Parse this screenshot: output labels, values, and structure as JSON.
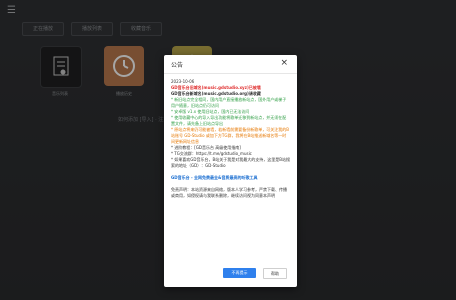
{
  "app": {
    "menu_icon": "hamburger-menu-icon",
    "tabs": [
      {
        "label": "正在播放"
      },
      {
        "label": "播放列表"
      },
      {
        "label": "收藏音乐"
      }
    ],
    "tiles": [
      {
        "label": "音乐列表",
        "icon": "music-list-icon",
        "color": "#1f2021"
      },
      {
        "label": "播放历史",
        "icon": "history-clock-icon",
        "color": "#b9794e"
      },
      {
        "label": "",
        "icon": "star-icon",
        "color": "#b8a64a"
      }
    ],
    "hint": "如何添加 [导入] · 注意事项 · 共 7 行"
  },
  "dialog": {
    "title": "公告",
    "lines": [
      {
        "text": "2023-10-06",
        "cls": ""
      },
      {
        "text": "GD音乐台旧域名(music.gdstudio.xyz)已被墙",
        "cls": "red"
      },
      {
        "text": "GD音乐台新域名(music.gdstudio.org)请收藏",
        "cls": "b"
      },
      {
        "text": "* 新旧站点完全相同，国内用户直接播放新站点，国外用户或梯子用户随意，旧站点仍可访问",
        "cls": "green"
      },
      {
        "text": "* 安卓版 v1.x 使用旧站点，国内已无法访问",
        "cls": "green"
      },
      {
        "text": "* 使用收藏中心的导入导出功能将歌单迁移到新站点，并无须在配置文件，请先备上旧站点导出",
        "cls": "green"
      },
      {
        "text": "* 原站点将来仍可能被墙，若新墙前需要备份新歌单，可关注我的B站账号 GD-Studio 或加下方TG群，我将在B站推送新域名等一时间更新网址信息",
        "cls": "orange"
      },
      {
        "text": "* 进阶教程：[GD音乐台 高级使用指南]",
        "cls": ""
      },
      {
        "text": "* TG交流群：https://t.me/gdstudio_music",
        "cls": ""
      },
      {
        "text": "* 如果喜欢GD音乐台，B站关于我是对我最大的支持，这里是B站搜索的地址（GD）：GD-Studio",
        "cls": ""
      },
      {
        "text": "",
        "cls": "gap"
      },
      {
        "text": "GD音乐台 - 全网免费最全&音质最高的听歌工具",
        "cls": "blue-b"
      },
      {
        "text": "",
        "cls": "gap"
      },
      {
        "text": "免责声明：本站资源来自网络，版本人学习参考，严禁下载、传播或商用，如侵权请与我联系删除，继续访问视为同意本声明",
        "cls": ""
      }
    ],
    "primary_button": "不再提示",
    "secondary_button": "帮助"
  }
}
